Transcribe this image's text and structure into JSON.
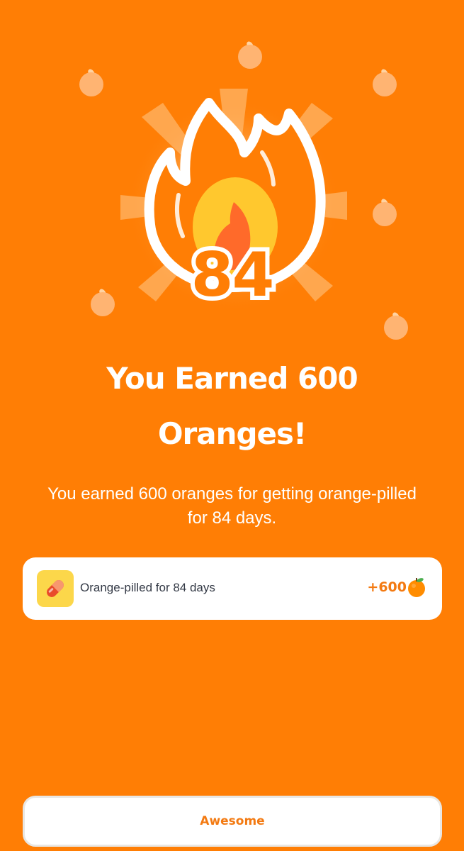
{
  "hero": {
    "icon": "fire-icon",
    "streak_days": "84"
  },
  "title": "You Earned 600 Oranges!",
  "subtitle": "You earned 600 oranges for getting orange-pilled for 84 days.",
  "reward": {
    "icon": "pill-icon",
    "label": "Orange-pilled for 84 days",
    "amount": "+600",
    "currency_icon": "orange-icon"
  },
  "button": {
    "label": "Awesome"
  },
  "colors": {
    "background": "#FF7E05",
    "accent": "#F37A12",
    "card": "#FFFFFF",
    "pill_box": "#FCD74A"
  }
}
